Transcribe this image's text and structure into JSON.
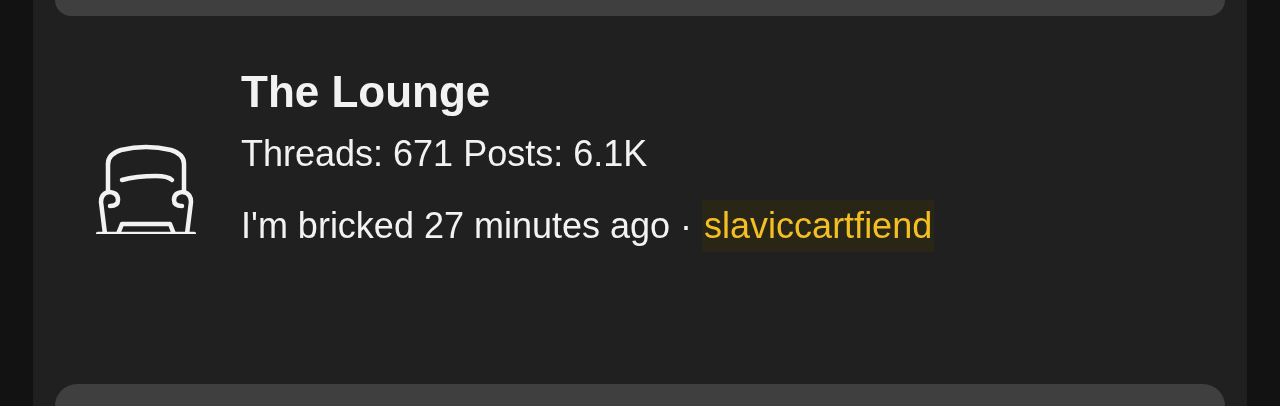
{
  "forum": {
    "title": "The Lounge",
    "stats": "Threads: 671 Posts: 6.1K",
    "latest_thread": "I'm bricked",
    "latest_time": "27 minutes ago",
    "separator": "·",
    "latest_user": "slaviccartfiend"
  }
}
